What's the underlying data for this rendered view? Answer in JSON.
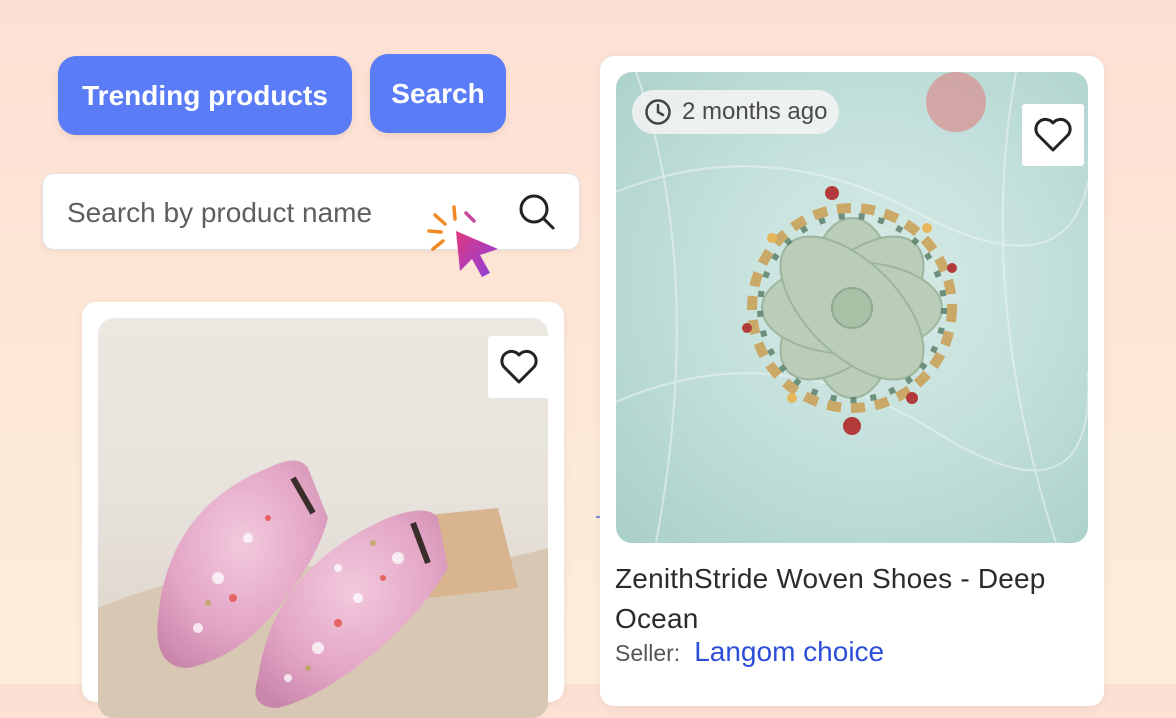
{
  "buttons": {
    "trending_label": "Trending products",
    "search_label": "Search"
  },
  "search": {
    "placeholder": "Search by product name",
    "value": ""
  },
  "cards": {
    "left": {
      "image_alt": "Pink floral woven slip-on shoes",
      "favorite_icon": "heart-icon"
    },
    "right": {
      "time_label": "2 months ago",
      "time_icon": "clock-icon",
      "favorite_icon": "heart-icon",
      "title": "ZenithStride Woven Shoes - Deep Ocean",
      "seller_label": "Seller:",
      "seller_name": "Langom choice"
    }
  },
  "colors": {
    "accent": "#5b7cf7",
    "link": "#2d4fd8",
    "cursor_gradient_start": "#e0397f",
    "cursor_gradient_end": "#8a3fe0",
    "spark": "#f08a24"
  }
}
